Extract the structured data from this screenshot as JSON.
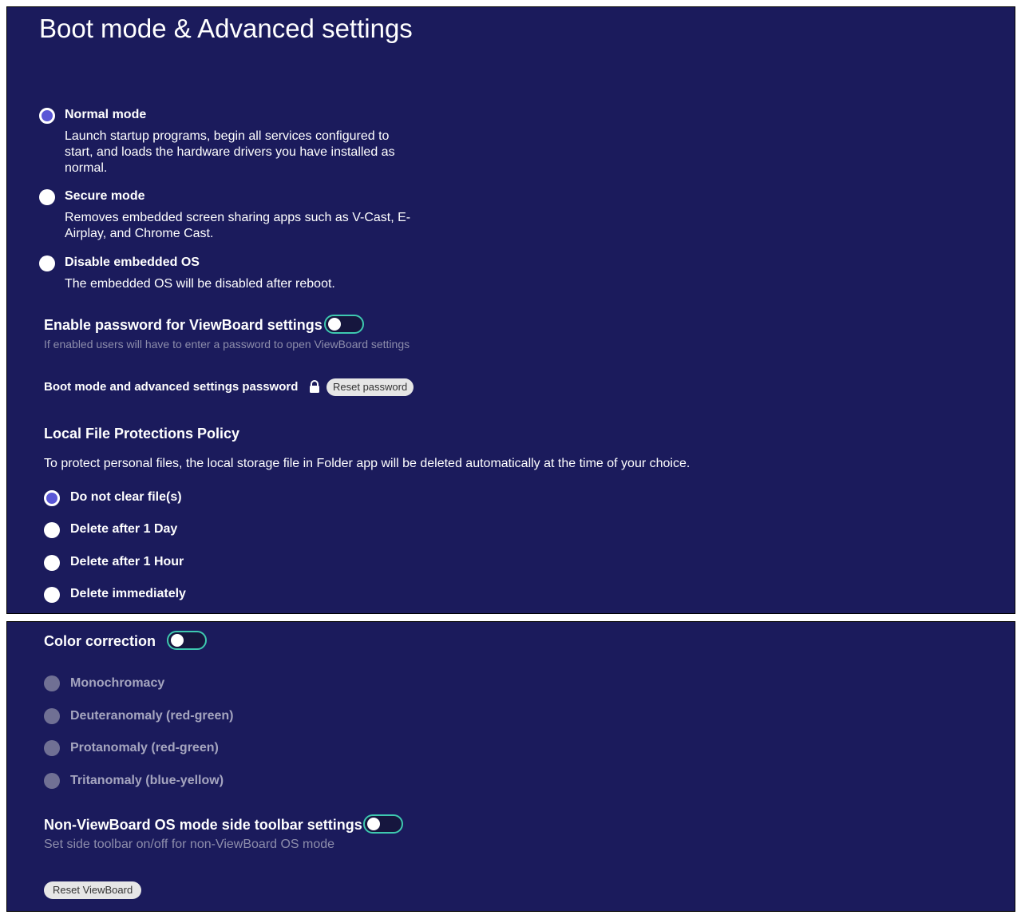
{
  "header": {
    "title": "Boot mode & Advanced settings"
  },
  "boot_modes": [
    {
      "label": "Normal mode",
      "description": "Launch startup programs, begin all services configured to start, and loads the hardware drivers you have installed as normal.",
      "selected": true
    },
    {
      "label": "Secure mode",
      "description": "Removes embedded screen sharing apps such as V-Cast, E-Airplay, and Chrome Cast.",
      "selected": false
    },
    {
      "label": "Disable embedded OS",
      "description": "The embedded OS will be disabled after reboot.",
      "selected": false
    }
  ],
  "password_setting": {
    "label": "Enable password for ViewBoard settings",
    "hint": "If enabled users will have to enter a password to open ViewBoard settings",
    "enabled": false
  },
  "password_row": {
    "label": "Boot mode and advanced settings password",
    "icon": "lock-icon",
    "reset_button": "Reset password"
  },
  "file_policy": {
    "title": "Local File Protections Policy",
    "description": "To protect personal files, the local storage file in Folder app will be deleted automatically at the time of your choice.",
    "options": [
      {
        "label": "Do not clear file(s)",
        "selected": true
      },
      {
        "label": "Delete after 1 Day",
        "selected": false
      },
      {
        "label": "Delete after 1 Hour",
        "selected": false
      },
      {
        "label": "Delete immediately",
        "selected": false
      }
    ]
  },
  "color_correction": {
    "label": "Color correction",
    "enabled": false,
    "options": [
      {
        "label": "Monochromacy"
      },
      {
        "label": "Deuteranomaly (red-green)"
      },
      {
        "label": "Protanomaly (red-green)"
      },
      {
        "label": "Tritanomaly (blue-yellow)"
      }
    ]
  },
  "toolbar_setting": {
    "label": "Non-ViewBoard OS mode side toolbar settings",
    "hint": "Set side toolbar on/off for non-ViewBoard OS mode",
    "enabled": false
  },
  "reset_viewboard": {
    "label": "Reset ViewBoard"
  },
  "colors": {
    "background": "#1b1b5c",
    "accent": "#5a57d6",
    "toggle_border": "#3ec9b0"
  }
}
